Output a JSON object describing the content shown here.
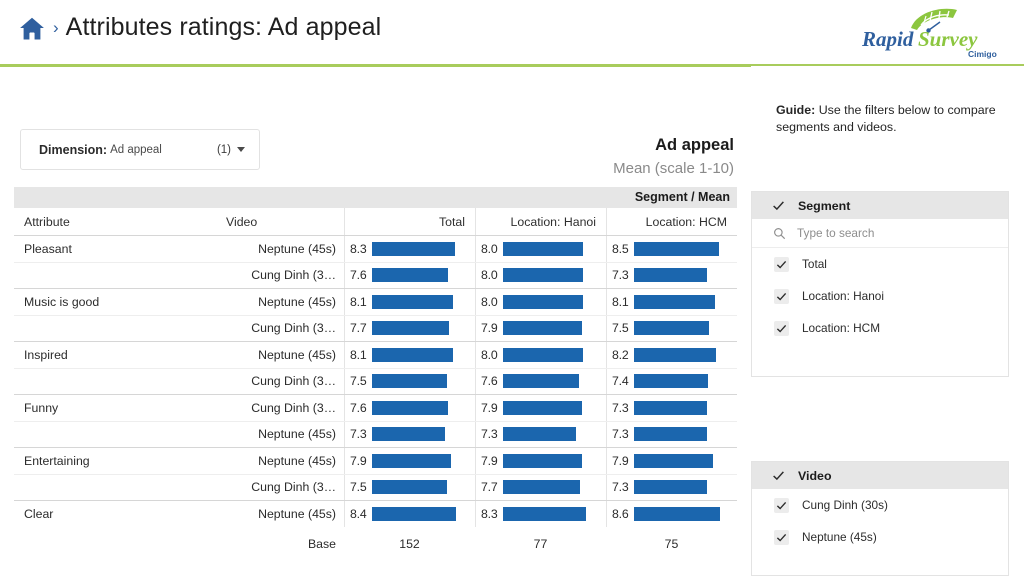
{
  "header": {
    "home_icon": "home-icon",
    "breadcrumb_separator": "›",
    "title": "Attributes ratings: Ad appeal",
    "logo": {
      "rapid": "Rapid",
      "survey": "Survey",
      "sub": "Cimigo"
    }
  },
  "dimension": {
    "label": "Dimension:",
    "value": "Ad appeal",
    "count": "(1)",
    "caret_icon": "chevron-down-icon"
  },
  "chart_title": "Ad appeal",
  "chart_subtitle": "Mean (scale 1-10)",
  "table": {
    "band_label": "Segment / Mean",
    "headers": {
      "attribute": "Attribute",
      "video": "Video",
      "total": "Total",
      "hanoi": "Location: Hanoi",
      "hcm": "Location: HCM"
    },
    "base_label": "Base",
    "base": {
      "total": "152",
      "hanoi": "77",
      "hcm": "75"
    }
  },
  "chart_data": {
    "type": "bar",
    "title": "Ad appeal",
    "subtitle": "Mean (scale 1-10)",
    "xlabel": "Mean",
    "ylabel": "Attribute / Video",
    "xlim": [
      0,
      10
    ],
    "grid": false,
    "legend": "none",
    "categories": [
      "Total",
      "Location: Hanoi",
      "Location: HCM"
    ],
    "base": [
      152,
      77,
      75
    ],
    "rows": [
      {
        "attribute": "Pleasant",
        "video": "Neptune (45s)",
        "values": [
          8.3,
          8.0,
          8.5
        ],
        "group_start": true
      },
      {
        "attribute": "",
        "video": "Cung Dinh (3…",
        "values": [
          7.6,
          8.0,
          7.3
        ],
        "group_start": false
      },
      {
        "attribute": "Music is good",
        "video": "Neptune (45s)",
        "values": [
          8.1,
          8.0,
          8.1
        ],
        "group_start": true
      },
      {
        "attribute": "",
        "video": "Cung Dinh (3…",
        "values": [
          7.7,
          7.9,
          7.5
        ],
        "group_start": false
      },
      {
        "attribute": "Inspired",
        "video": "Neptune (45s)",
        "values": [
          8.1,
          8.0,
          8.2
        ],
        "group_start": true
      },
      {
        "attribute": "",
        "video": "Cung Dinh (3…",
        "values": [
          7.5,
          7.6,
          7.4
        ],
        "group_start": false
      },
      {
        "attribute": "Funny",
        "video": "Cung Dinh (3…",
        "values": [
          7.6,
          7.9,
          7.3
        ],
        "group_start": true
      },
      {
        "attribute": "",
        "video": "Neptune (45s)",
        "values": [
          7.3,
          7.3,
          7.3
        ],
        "group_start": false
      },
      {
        "attribute": "Entertaining",
        "video": "Neptune (45s)",
        "values": [
          7.9,
          7.9,
          7.9
        ],
        "group_start": true
      },
      {
        "attribute": "",
        "video": "Cung Dinh (3…",
        "values": [
          7.5,
          7.7,
          7.3
        ],
        "group_start": false
      },
      {
        "attribute": "Clear",
        "video": "Neptune (45s)",
        "values": [
          8.4,
          8.3,
          8.6
        ],
        "group_start": true
      }
    ],
    "bar_color": "#1b66ae"
  },
  "sidebar": {
    "guide_label": "Guide:",
    "guide_text": " Use the filters below to compare segments and videos.",
    "segment_panel": {
      "title": "Segment",
      "header_check_icon": "check-icon",
      "search_icon": "search-icon",
      "search_placeholder": "Type to search",
      "options": [
        {
          "label": "Total",
          "checked": true
        },
        {
          "label": "Location: Hanoi",
          "checked": true
        },
        {
          "label": "Location: HCM",
          "checked": true
        }
      ]
    },
    "video_panel": {
      "title": "Video",
      "header_check_icon": "check-icon",
      "options": [
        {
          "label": "Cung Dinh (30s)",
          "checked": true
        },
        {
          "label": "Neptune (45s)",
          "checked": true
        }
      ]
    }
  },
  "colors": {
    "accent_blue": "#1b66ae",
    "brand_green": "#a8cc5c",
    "brand_blue": "#2f5f9e"
  }
}
